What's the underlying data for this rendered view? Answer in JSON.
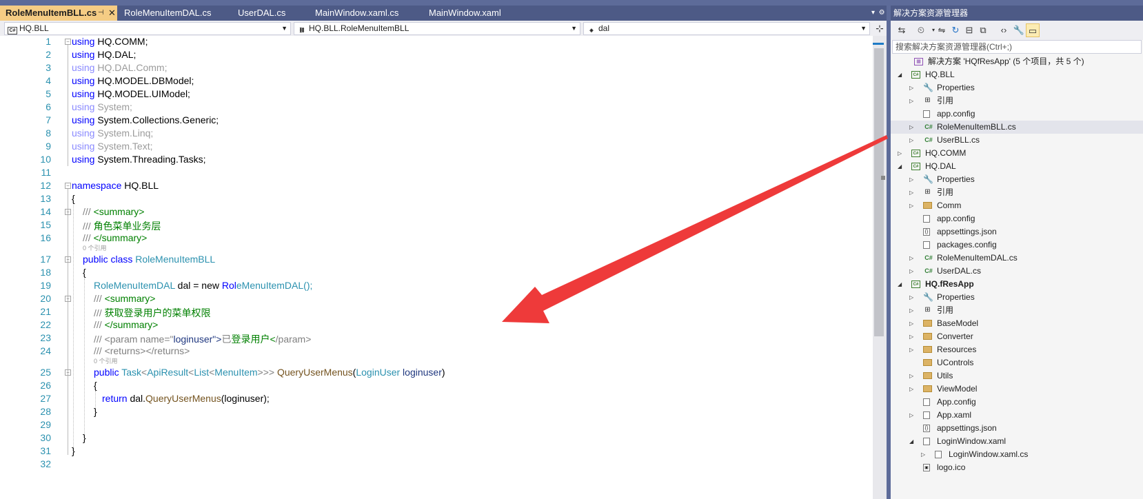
{
  "tabs": [
    {
      "label": "RoleMenuItemBLL.cs",
      "active": true
    },
    {
      "label": "RoleMenuItemDAL.cs",
      "active": false
    },
    {
      "label": "UserDAL.cs",
      "active": false
    },
    {
      "label": "MainWindow.xaml.cs",
      "active": false
    },
    {
      "label": "MainWindow.xaml",
      "active": false
    }
  ],
  "navbar": {
    "project": "HQ.BLL",
    "class": "HQ.BLL.RoleMenuItemBLL",
    "member": "dal"
  },
  "code": {
    "lines": [
      {
        "n": "1",
        "t": "using HQ.COMM;"
      },
      {
        "n": "2",
        "t": "using HQ.DAL;"
      },
      {
        "n": "3",
        "t": "using HQ.DAL.Comm;"
      },
      {
        "n": "4",
        "t": "using HQ.MODEL.DBModel;"
      },
      {
        "n": "5",
        "t": "using HQ.MODEL.UIModel;"
      },
      {
        "n": "6",
        "t": "using System;"
      },
      {
        "n": "7",
        "t": "using System.Collections.Generic;"
      },
      {
        "n": "8",
        "t": "using System.Linq;"
      },
      {
        "n": "9",
        "t": "using System.Text;"
      },
      {
        "n": "10",
        "t": "using System.Threading.Tasks;"
      },
      {
        "n": "11",
        "t": ""
      },
      {
        "n": "12",
        "t": "namespace HQ.BLL"
      },
      {
        "n": "13",
        "t": "{"
      },
      {
        "n": "14",
        "t": "/// <summary>"
      },
      {
        "n": "15",
        "t": "/// 角色菜单业务层"
      },
      {
        "n": "16",
        "t": "/// </summary>"
      },
      {
        "n": "17",
        "t": "public class RoleMenuItemBLL"
      },
      {
        "n": "18",
        "t": "{"
      },
      {
        "n": "19",
        "t": "RoleMenuItemDAL dal = new RoleMenuItemDAL();"
      },
      {
        "n": "20",
        "t": "/// <summary>"
      },
      {
        "n": "21",
        "t": "/// 获取登录用户的菜单权限"
      },
      {
        "n": "22",
        "t": "/// </summary>"
      },
      {
        "n": "23",
        "t": "/// <param name=\"loginuser\">已登录用户</param>"
      },
      {
        "n": "24",
        "t": "/// <returns></returns>"
      },
      {
        "n": "25",
        "t": "public Task<ApiResult<List<MenuItem>>> QueryUserMenus(LoginUser loginuser)"
      },
      {
        "n": "26",
        "t": "{"
      },
      {
        "n": "27",
        "t": "return dal.QueryUserMenus(loginuser);"
      },
      {
        "n": "28",
        "t": "}"
      },
      {
        "n": "29",
        "t": ""
      },
      {
        "n": "30",
        "t": "}"
      },
      {
        "n": "31",
        "t": "}"
      },
      {
        "n": "32",
        "t": ""
      }
    ],
    "codelens": [
      "0 个引用",
      "0 个引用"
    ]
  },
  "solution_explorer": {
    "title": "解决方案资源管理器",
    "search_placeholder": "搜索解决方案资源管理器(Ctrl+;)",
    "items": [
      {
        "label": "解决方案 'HQfResApp' (5 个项目，共 5 个)",
        "icon": "solution-icon"
      },
      {
        "label": "HQ.BLL",
        "icon": "project-icon",
        "expanded": true
      },
      {
        "label": "Properties",
        "icon": "wrench-icon"
      },
      {
        "label": "引用",
        "icon": "references-icon"
      },
      {
        "label": "app.config",
        "icon": "config-file-icon"
      },
      {
        "label": "RoleMenuItemBLL.cs",
        "icon": "csharp-file-icon",
        "selected": true
      },
      {
        "label": "UserBLL.cs",
        "icon": "csharp-file-icon"
      },
      {
        "label": "HQ.COMM",
        "icon": "project-icon",
        "expanded": false
      },
      {
        "label": "HQ.DAL",
        "icon": "project-icon",
        "expanded": true
      },
      {
        "label": "Properties",
        "icon": "wrench-icon"
      },
      {
        "label": "引用",
        "icon": "references-icon"
      },
      {
        "label": "Comm",
        "icon": "folder-icon"
      },
      {
        "label": "app.config",
        "icon": "config-file-icon"
      },
      {
        "label": "appsettings.json",
        "icon": "json-file-icon"
      },
      {
        "label": "packages.config",
        "icon": "config-file-icon"
      },
      {
        "label": "RoleMenuItemDAL.cs",
        "icon": "csharp-file-icon"
      },
      {
        "label": "UserDAL.cs",
        "icon": "csharp-file-icon"
      },
      {
        "label": "HQ.fResApp",
        "icon": "project-icon",
        "expanded": true,
        "bold": true
      },
      {
        "label": "Properties",
        "icon": "wrench-icon"
      },
      {
        "label": "引用",
        "icon": "references-icon"
      },
      {
        "label": "BaseModel",
        "icon": "folder-icon"
      },
      {
        "label": "Converter",
        "icon": "folder-icon"
      },
      {
        "label": "Resources",
        "icon": "folder-icon"
      },
      {
        "label": "UControls",
        "icon": "folder-icon"
      },
      {
        "label": "Utils",
        "icon": "folder-icon"
      },
      {
        "label": "ViewModel",
        "icon": "folder-icon"
      },
      {
        "label": "App.config",
        "icon": "config-file-icon"
      },
      {
        "label": "App.xaml",
        "icon": "xaml-file-icon"
      },
      {
        "label": "appsettings.json",
        "icon": "json-file-icon"
      },
      {
        "label": "LoginWindow.xaml",
        "icon": "xaml-file-icon",
        "expanded": true
      },
      {
        "label": "LoginWindow.xaml.cs",
        "icon": "file-icon"
      },
      {
        "label": "logo.ico",
        "icon": "ico-file-icon"
      }
    ]
  },
  "colors": {
    "tab_active": "#f5cc84",
    "chrome": "#5d6b99",
    "arrow": "#ee3a3a"
  }
}
